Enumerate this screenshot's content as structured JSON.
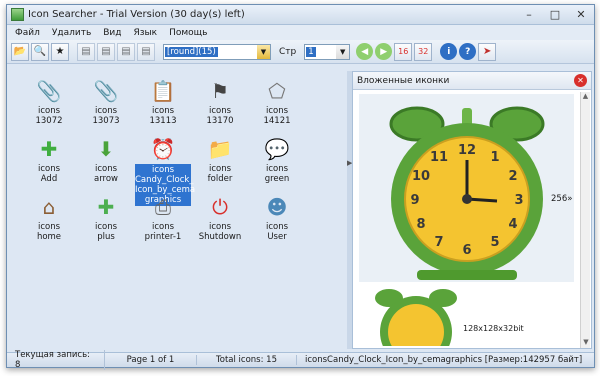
{
  "window": {
    "title": "Icon Searcher - Trial Version (30 day(s) left)"
  },
  "menu": {
    "items": [
      "Файл",
      "Удалить",
      "Вид",
      "Язык",
      "Помощь"
    ]
  },
  "toolbar": {
    "search_combo_value": "[round](15)",
    "page_label": "Стр",
    "page_value": "1"
  },
  "icons": [
    {
      "line1": "icons",
      "line2": "13072",
      "icon": "clip-icon",
      "color": "#555555"
    },
    {
      "line1": "icons",
      "line2": "13073",
      "icon": "clip-icon",
      "color": "#555555"
    },
    {
      "line1": "icons",
      "line2": "13113",
      "icon": "document-icon",
      "color": "#444444"
    },
    {
      "line1": "icons",
      "line2": "13170",
      "icon": "fork-icon",
      "color": "#444444"
    },
    {
      "line1": "icons",
      "line2": "14121",
      "icon": "pentagon-icon",
      "color": "#777777"
    },
    {
      "line1": "icons",
      "line2": "Add",
      "icon": "add-icon",
      "color": "#3fae3f"
    },
    {
      "line1": "icons",
      "line2": "arrow",
      "icon": "arrow-icon",
      "color": "#4aa33a"
    },
    {
      "line1": "icons",
      "line2": "Candy_Clock_\nIcon_by_cema\ngraphics",
      "icon": "clock-icon",
      "color": "#6db548",
      "selected": true
    },
    {
      "line1": "icons",
      "line2": "folder",
      "icon": "folder-icon",
      "color": "#a0722a"
    },
    {
      "line1": "icons",
      "line2": "green",
      "icon": "chat-icon",
      "color": "#6aa63a"
    },
    {
      "line1": "icons",
      "line2": "home",
      "icon": "home-icon",
      "color": "#8b5e34"
    },
    {
      "line1": "icons",
      "line2": "plus",
      "icon": "plus-icon",
      "color": "#4caf50"
    },
    {
      "line1": "icons",
      "line2": "printer-1",
      "icon": "printer-icon",
      "color": "#666666"
    },
    {
      "line1": "icons",
      "line2": "Shutdown",
      "icon": "power-icon",
      "color": "#d8302c"
    },
    {
      "line1": "icons",
      "line2": "User",
      "icon": "user-icon",
      "color": "#4b88b8"
    }
  ],
  "right_panel": {
    "title": "Вложенные иконки",
    "size_label": "256»",
    "thumb_dims": "128x128x32bit"
  },
  "status": {
    "current": "Текущая запись: 8",
    "page": "Page 1 of 1",
    "total": "Total icons: 15",
    "file": "iconsCandy_Clock_Icon_by_cemagraphics [Размер:142957 байт]"
  },
  "colors": {
    "accent": "#2f74d0",
    "clock_green": "#6db548",
    "clock_face": "#f4c430"
  }
}
